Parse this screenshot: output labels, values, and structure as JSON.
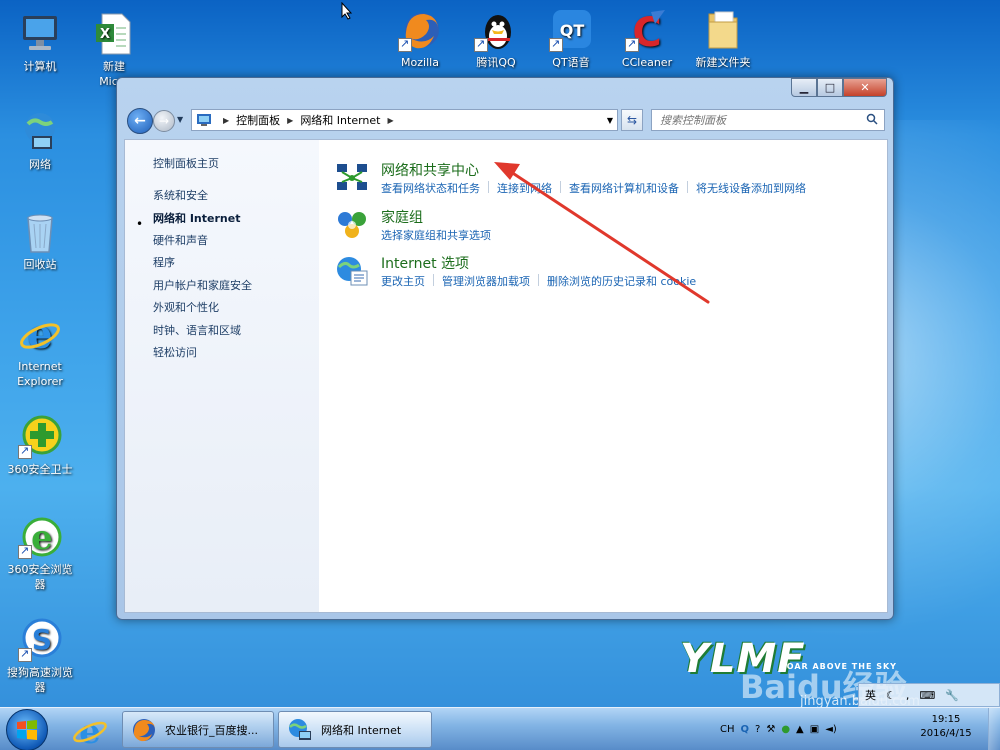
{
  "desktop": {
    "icons": [
      {
        "label": "计算机"
      },
      {
        "label": "新建\nMicro"
      },
      {
        "label": "网络"
      },
      {
        "label": "回收站"
      },
      {
        "label": "Internet\nExplorer"
      },
      {
        "label": "360安全卫士"
      },
      {
        "label": "360安全浏览\n器"
      },
      {
        "label": "搜狗高速浏览\n器"
      },
      {
        "label": "Mozilla"
      },
      {
        "label": "腾讯QQ"
      },
      {
        "label": "QT语音"
      },
      {
        "label": "CCleaner"
      },
      {
        "label": "新建文件夹"
      }
    ]
  },
  "window": {
    "breadcrumb": [
      "控制面板",
      "网络和 Internet"
    ],
    "search_placeholder": "搜索控制面板"
  },
  "sidebar": {
    "home": "控制面板主页",
    "items": [
      {
        "label": "系统和安全"
      },
      {
        "label": "网络和 Internet"
      },
      {
        "label": "硬件和声音"
      },
      {
        "label": "程序"
      },
      {
        "label": "用户帐户和家庭安全"
      },
      {
        "label": "外观和个性化"
      },
      {
        "label": "时钟、语言和区域"
      },
      {
        "label": "轻松访问"
      }
    ]
  },
  "categories": [
    {
      "title": "网络和共享中心",
      "links": [
        "查看网络状态和任务",
        "连接到网络",
        "查看网络计算机和设备",
        "将无线设备添加到网络"
      ]
    },
    {
      "title": "家庭组",
      "links": [
        "选择家庭组和共享选项"
      ]
    },
    {
      "title": "Internet 选项",
      "links": [
        "更改主页",
        "管理浏览器加载项",
        "删除浏览的历史记录和 cookie"
      ]
    }
  ],
  "taskbar": {
    "buttons": [
      {
        "label": "农业银行_百度搜..."
      },
      {
        "label": "网络和 Internet"
      }
    ],
    "tray_lang": "CH",
    "time": "19:15",
    "date": "2016/4/15"
  },
  "branding": {
    "logo": "YLMF",
    "tagline": "SOAR ABOVE THE SKY",
    "watermark": "Baidu经验",
    "watermark_url": "jingyan.baidu.com"
  },
  "colors": {
    "link": "#1a64b3",
    "category_title": "#1c6d1c",
    "arrow": "#e0382c"
  }
}
